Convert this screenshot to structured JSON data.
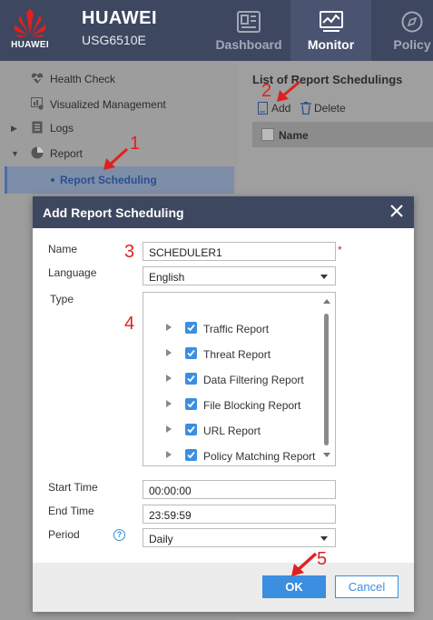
{
  "header": {
    "brand": "HUAWEI",
    "logo_text": "HUAWEI",
    "model": "USG6510E",
    "nav": [
      {
        "label": "Dashboard",
        "icon": "dashboard-icon"
      },
      {
        "label": "Monitor",
        "icon": "monitor-icon"
      },
      {
        "label": "Policy",
        "icon": "compass-icon"
      }
    ],
    "active_nav": "Monitor",
    "brand_color": "#e02020",
    "header_color": "#3d4760"
  },
  "sidebar": {
    "items": [
      {
        "label": "Health Check",
        "icon": "heart-pulse-icon"
      },
      {
        "label": "Visualized Management",
        "icon": "chart-gear-icon"
      },
      {
        "label": "Logs",
        "icon": "document-icon"
      },
      {
        "label": "Report",
        "icon": "pie-chart-icon"
      }
    ],
    "selected_child": "Report Scheduling"
  },
  "list": {
    "title": "List of Report Schedulings",
    "add_label": "Add",
    "delete_label": "Delete",
    "column_name": "Name"
  },
  "dialog": {
    "title": "Add Report Scheduling",
    "name_label": "Name",
    "name_value": "SCHEDULER1",
    "required_mark": "*",
    "language_label": "Language",
    "language_value": "English",
    "type_label": "Type",
    "report_types": [
      {
        "label": "Traffic Report",
        "checked": true
      },
      {
        "label": "Threat Report",
        "checked": true
      },
      {
        "label": "Data Filtering Report",
        "checked": true
      },
      {
        "label": "File Blocking Report",
        "checked": true
      },
      {
        "label": "URL Report",
        "checked": true
      },
      {
        "label": "Policy Matching Report",
        "checked": true
      }
    ],
    "start_time_label": "Start Time",
    "start_time_value": "00:00:00",
    "end_time_label": "End Time",
    "end_time_value": "23:59:59",
    "period_label": "Period",
    "period_value": "Daily",
    "help_glyph": "?",
    "ok_label": "OK",
    "cancel_label": "Cancel",
    "accent_color": "#3b8ee0"
  },
  "annotations": {
    "step1": "1",
    "step2": "2",
    "step3": "3",
    "step4": "4",
    "step5": "5",
    "color": "#e02020"
  }
}
